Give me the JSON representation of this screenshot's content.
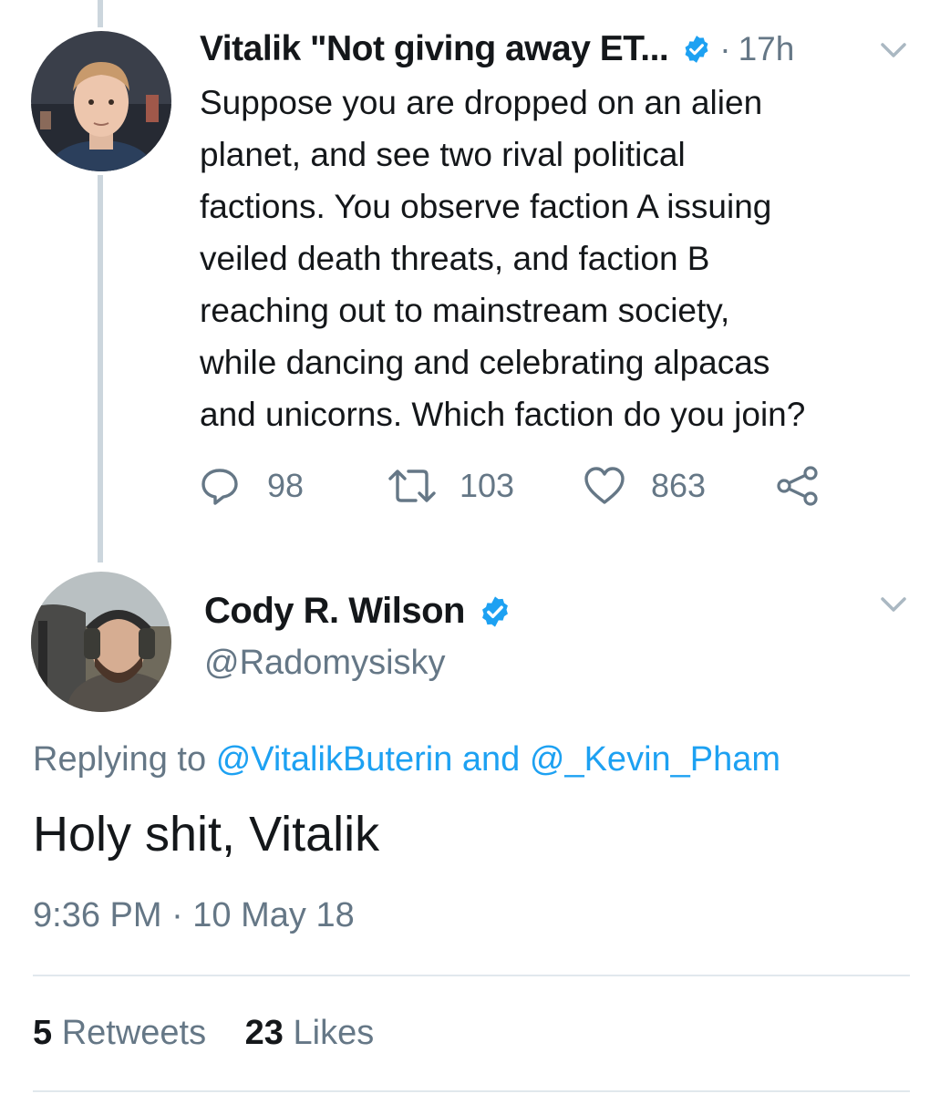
{
  "parent_tweet": {
    "display_name": "Vitalik \"Not giving away ET...",
    "time_separator": "·",
    "time": "17h",
    "lines": [
      "Suppose you are dropped on an alien",
      "planet, and see two rival political",
      "factions. You observe faction A issuing",
      "veiled death threats, and faction B",
      "reaching out to mainstream society,",
      "while dancing and celebrating alpacas",
      "and unicorns. Which faction do you join?"
    ],
    "replies": "98",
    "retweets": "103",
    "likes": "863",
    "icons": [
      "reply-icon",
      "retweet-icon",
      "like-icon",
      "share-icon"
    ]
  },
  "main_tweet": {
    "display_name": "Cody R. Wilson",
    "handle": "@Radomysisky",
    "replying_prefix": "Replying to",
    "replying_user1": "@VitalikButerin",
    "replying_and": "and",
    "replying_user2": "@_Kevin_Pham",
    "text": "Holy shit, Vitalik",
    "timestamp": "9:36 PM · 10 May 18",
    "retweets_count": "5",
    "retweets_label": "Retweets",
    "likes_count": "23",
    "likes_label": "Likes"
  },
  "colors": {
    "accent": "#1da1f2",
    "muted": "#657786",
    "text": "#14171a",
    "thread": "#ccd6dd"
  }
}
